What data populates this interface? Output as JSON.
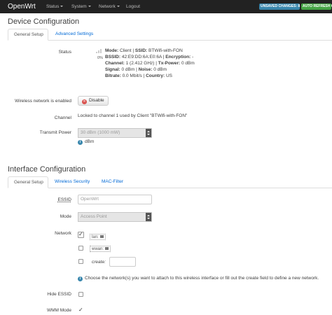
{
  "header": {
    "brand": "OpenWrt",
    "menu": [
      {
        "label": "Status",
        "dropdown": true
      },
      {
        "label": "System",
        "dropdown": true
      },
      {
        "label": "Network",
        "dropdown": true
      },
      {
        "label": "Logout",
        "dropdown": false
      }
    ],
    "unsaved_badge": "UNSAVED CHANGES: 8",
    "refresh_badge": "AUTO REFRESH ON",
    "colors": {
      "unsaved": "#3a87ad",
      "refresh": "#46a546",
      "navbar": "#222222"
    }
  },
  "device": {
    "title": "Device Configuration",
    "tabs": [
      "General Setup",
      "Advanced Settings"
    ],
    "active_tab": "General Setup",
    "status_label": "Status",
    "signal_percent": "0%",
    "status_lines": [
      {
        "k1": "Mode:",
        "v1": " Client | ",
        "k2": "SSID:",
        "v2": " BTWifi-with-FON"
      },
      {
        "k1": "BSSID:",
        "v1": " 42:E9:DD:6A:E0:6A | ",
        "k2": "Encryption:",
        "v2": " -"
      },
      {
        "k1": "Channel:",
        "v1": " 1 (2.412 GHz) | ",
        "k2": "Tx-Power:",
        "v2": " 0 dBm"
      },
      {
        "k1": "Signal:",
        "v1": " 0 dBm | ",
        "k2": "Noise:",
        "v2": " 0 dBm"
      },
      {
        "k1": "Bitrate:",
        "v1": " 0.0 Mbit/s | ",
        "k2": "Country:",
        "v2": " US"
      }
    ],
    "wireless_label": "Wireless network is enabled",
    "disable_button": "Disable",
    "channel_label": "Channel",
    "channel_value": "Locked to channel 1 used by Client \"BTWifi-with-FON\"",
    "txpower_label": "Transmit Power",
    "txpower_value": "30 dBm (1000 mW)",
    "txpower_unit": "dBm"
  },
  "interface": {
    "title": "Interface Configuration",
    "tabs": [
      "General Setup",
      "Wireless Security",
      "MAC-Filter"
    ],
    "active_tab": "General Setup",
    "essid_label": "ESSID",
    "essid_value": "OpenWrt",
    "mode_label": "Mode",
    "mode_value": "Access Point",
    "network_label": "Network",
    "networks": [
      {
        "name": "lan:",
        "checked": true
      },
      {
        "name": "wwan:",
        "checked": false
      }
    ],
    "create_label": "create:",
    "network_hint": "Choose the network(s) you want to attach to this wireless interface or fill out the create field to define a new network.",
    "hide_essid_label": "Hide ESSID",
    "hide_essid_checked": false,
    "wmm_label": "WMM Mode",
    "wmm_checked": true
  }
}
